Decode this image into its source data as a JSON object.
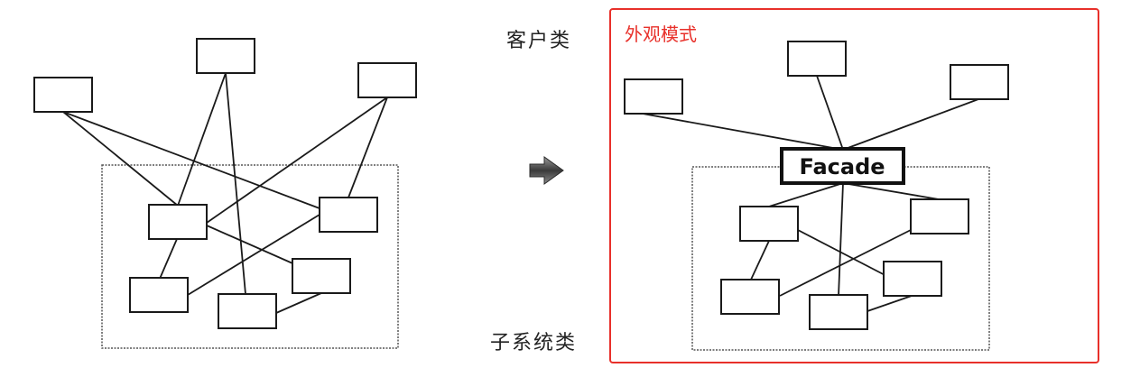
{
  "labels": {
    "client": "客户类",
    "subsystem": "子系统类",
    "facade_title": "外观模式",
    "facade_box": "Facade"
  },
  "colors": {
    "frame": "#e8302a",
    "title": "#e8302a",
    "ink": "#1a1a1a"
  }
}
